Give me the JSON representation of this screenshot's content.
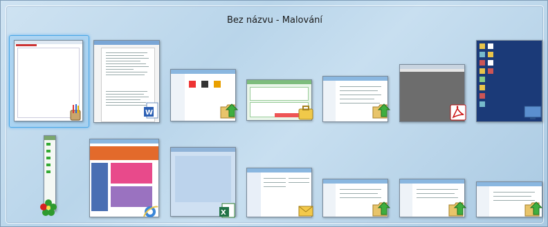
{
  "switcher": {
    "title": "Bez názvu - Malování",
    "windows_row1": [
      {
        "app": "paint",
        "icon": "paint-icon",
        "selected": true
      },
      {
        "app": "word",
        "icon": "word-icon"
      },
      {
        "app": "explorer",
        "icon": "folder-icon"
      },
      {
        "app": "messenger",
        "icon": "briefcase-icon"
      },
      {
        "app": "explorer",
        "icon": "folder-icon"
      },
      {
        "app": "acrobat",
        "icon": "pdf-icon"
      },
      {
        "app": "desktop",
        "icon": "desktop-icon"
      }
    ],
    "windows_row2": [
      {
        "app": "icq",
        "icon": "flower-icon"
      },
      {
        "app": "internet-explorer",
        "icon": "ie-icon"
      },
      {
        "app": "excel",
        "icon": "excel-icon"
      },
      {
        "app": "outlook",
        "icon": "envelope-icon"
      },
      {
        "app": "explorer",
        "icon": "folder-icon"
      },
      {
        "app": "explorer",
        "icon": "folder-icon"
      },
      {
        "app": "explorer",
        "icon": "folder-icon"
      }
    ]
  }
}
